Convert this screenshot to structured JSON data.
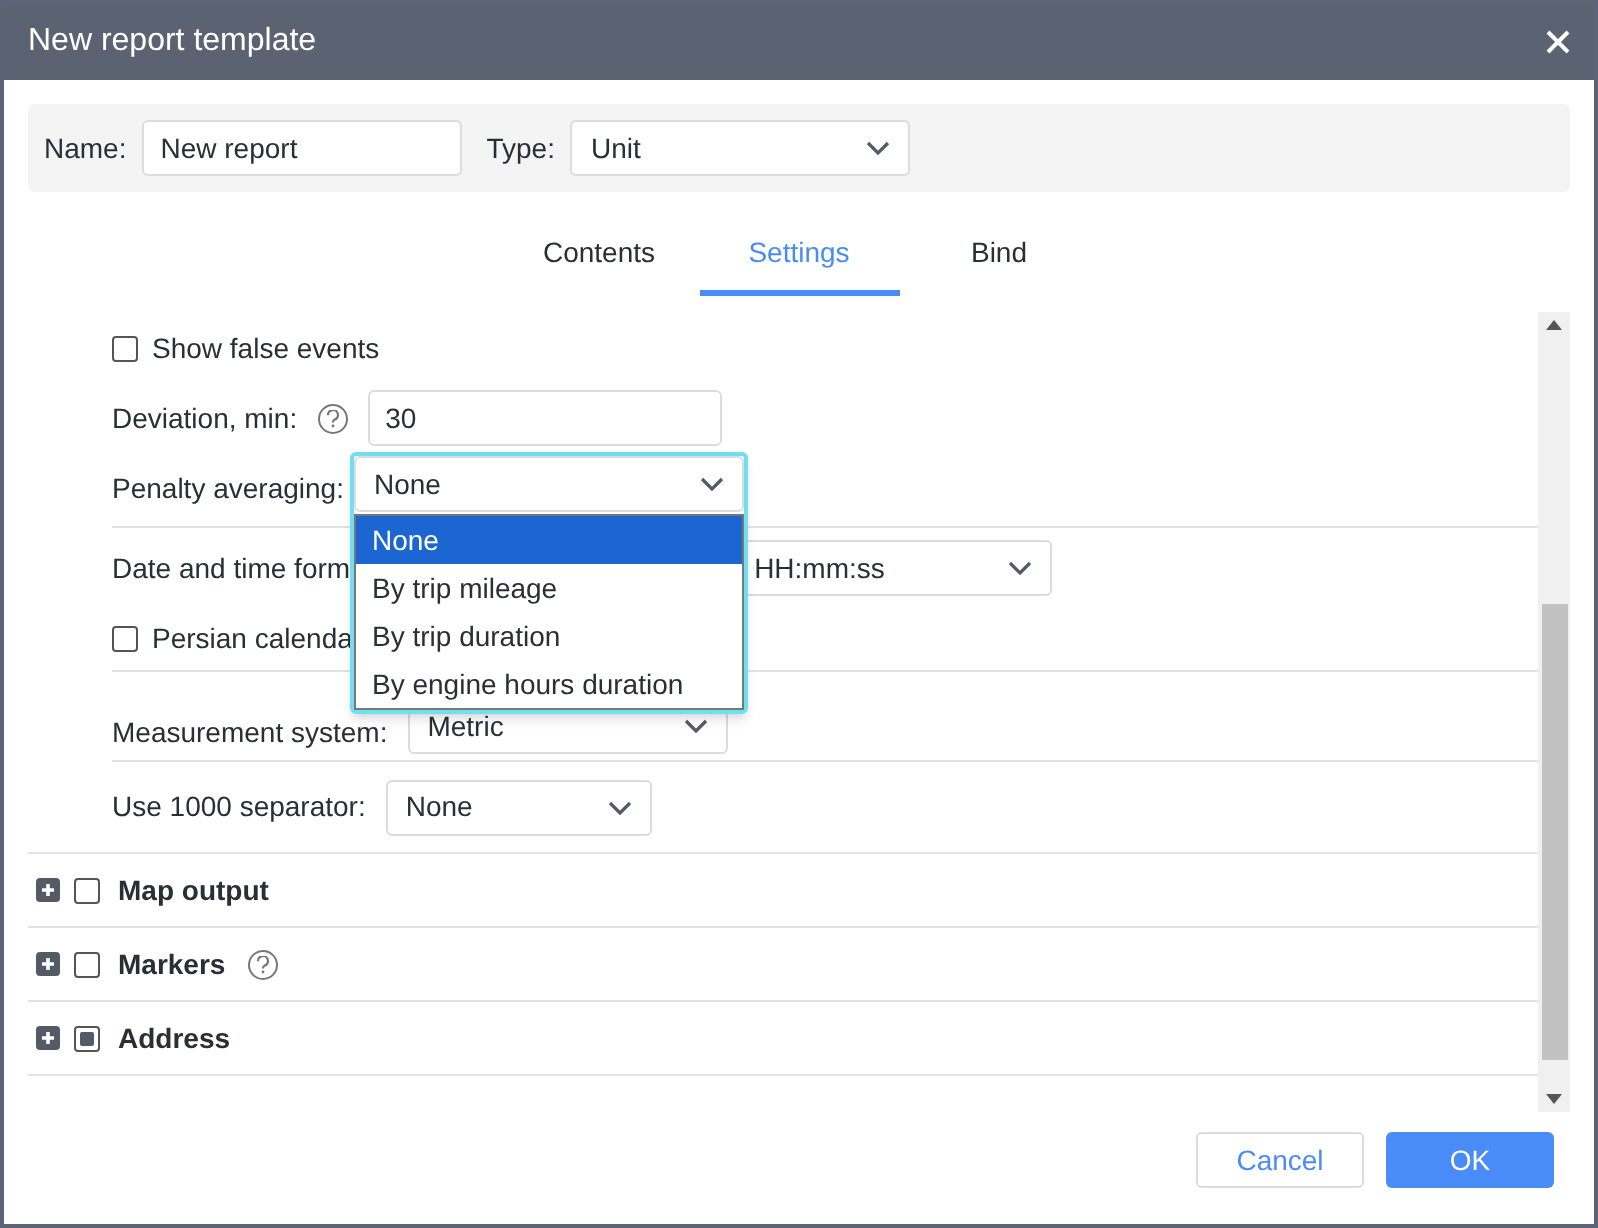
{
  "window": {
    "title": "New report template"
  },
  "header": {
    "name_label": "Name:",
    "name_value": "New report",
    "type_label": "Type:",
    "type_value": "Unit"
  },
  "tabs": [
    {
      "label": "Contents",
      "selected": false
    },
    {
      "label": "Settings",
      "selected": true
    },
    {
      "label": "Bind",
      "selected": false
    }
  ],
  "settings": {
    "show_false_events": {
      "label": "Show false events",
      "checked": false
    },
    "deviation": {
      "label": "Deviation, min:",
      "value": "30"
    },
    "penalty": {
      "label": "Penalty averaging:",
      "value": "None",
      "expanded": true,
      "options": [
        {
          "label": "None",
          "selected": true
        },
        {
          "label": "By trip mileage",
          "selected": false
        },
        {
          "label": "By trip duration",
          "selected": false
        },
        {
          "label": "By engine hours duration",
          "selected": false
        }
      ]
    },
    "date_format": {
      "label": "Date and time form",
      "time_value": "HH:mm:ss"
    },
    "persian_calendar": {
      "label": "Persian calenda",
      "checked": false
    },
    "measurement": {
      "label": "Measurement system:",
      "value": "Metric"
    },
    "separator": {
      "label": "Use 1000 separator:",
      "value": "None"
    }
  },
  "sections": [
    {
      "label": "Map output",
      "checked": false,
      "indeterminate": false,
      "help": false
    },
    {
      "label": "Markers",
      "checked": false,
      "indeterminate": false,
      "help": true
    },
    {
      "label": "Address",
      "checked": false,
      "indeterminate": true,
      "help": false
    }
  ],
  "buttons": {
    "cancel": "Cancel",
    "ok": "OK"
  }
}
